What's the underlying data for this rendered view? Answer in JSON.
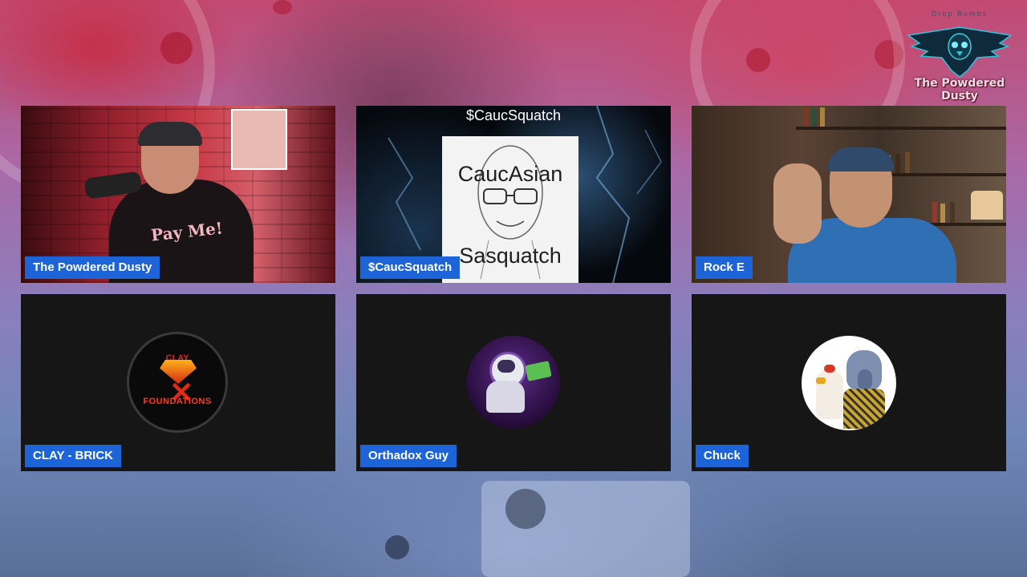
{
  "brand": {
    "tagline": "Drop Bombs",
    "name": "The Powdered Dusty"
  },
  "participants": [
    {
      "name": "The Powdered Dusty",
      "type": "camera",
      "shirt_text": "Pay Me!"
    },
    {
      "name": "$CaucSquatch",
      "type": "image",
      "overlay_caption": "$CaucSquatch",
      "card_line1": "CaucAsian",
      "card_line2": "Sasquatch"
    },
    {
      "name": "Rock E",
      "type": "camera"
    },
    {
      "name": "CLAY - BRICK",
      "type": "avatar",
      "avatar_text_top": "CLAY",
      "avatar_text_bottom": "FOUNDATIONS"
    },
    {
      "name": "Orthadox Guy",
      "type": "avatar"
    },
    {
      "name": "Chuck",
      "type": "avatar"
    }
  ],
  "colors": {
    "name_tag_bg": "#1d64d8",
    "tile_bg": "#161616"
  }
}
